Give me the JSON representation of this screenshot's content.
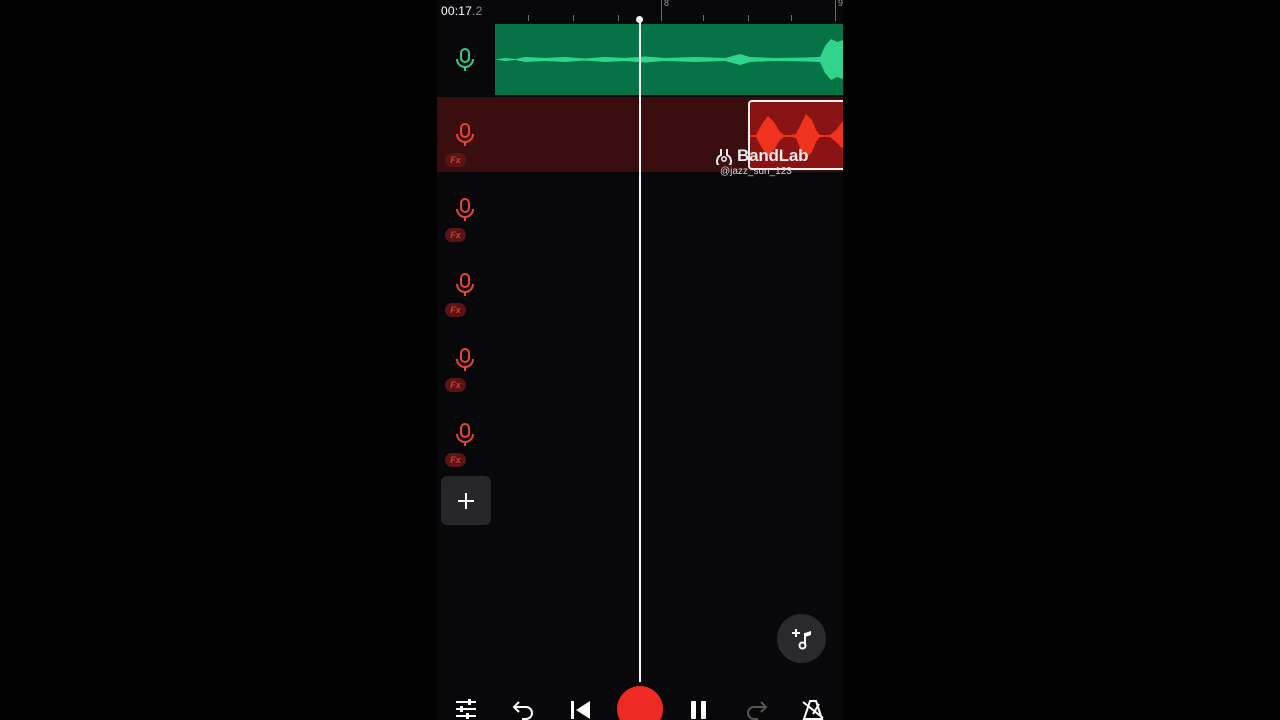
{
  "header": {
    "time_main": "00:17",
    "time_fraction": ".2",
    "bar_markers": [
      "8",
      "9"
    ]
  },
  "tracks": [
    {
      "type": "voice",
      "icon": "microphone-icon",
      "color": "#2ecc8a",
      "has_region": true,
      "region_color": "#067346",
      "fx": false
    },
    {
      "type": "voice",
      "icon": "microphone-icon",
      "color": "#e8443a",
      "has_region": true,
      "region_color": "#3a0d0f",
      "fx": true,
      "fx_label": "Fx"
    },
    {
      "type": "voice",
      "icon": "microphone-icon",
      "color": "#e8443a",
      "fx": true,
      "fx_label": "Fx"
    },
    {
      "type": "voice",
      "icon": "microphone-icon",
      "color": "#e8443a",
      "fx": true,
      "fx_label": "Fx"
    },
    {
      "type": "voice",
      "icon": "microphone-icon",
      "color": "#e8443a",
      "fx": true,
      "fx_label": "Fx"
    },
    {
      "type": "voice",
      "icon": "microphone-icon",
      "color": "#e8443a",
      "fx": true,
      "fx_label": "Fx"
    }
  ],
  "watermark": {
    "brand": "BandLab",
    "user": "@jazz_sun_123"
  },
  "buttons": {
    "add_track": "plus-icon",
    "add_instrument": "add-music-note-icon"
  },
  "transport": [
    {
      "name": "mixer-button",
      "icon": "sliders-icon"
    },
    {
      "name": "undo-button",
      "icon": "undo-icon"
    },
    {
      "name": "skip-to-start-button",
      "icon": "skip-back-icon"
    },
    {
      "name": "record-button",
      "icon": "record-icon",
      "color": "#ee2a24"
    },
    {
      "name": "pause-button",
      "icon": "pause-icon"
    },
    {
      "name": "redo-button",
      "icon": "redo-icon",
      "disabled": true
    },
    {
      "name": "metronome-button",
      "icon": "metronome-off-icon"
    }
  ],
  "colors": {
    "background": "#08070a",
    "green_track": "#2ecc8a",
    "red_track": "#e8443a",
    "playhead": "#f5f5f5"
  }
}
